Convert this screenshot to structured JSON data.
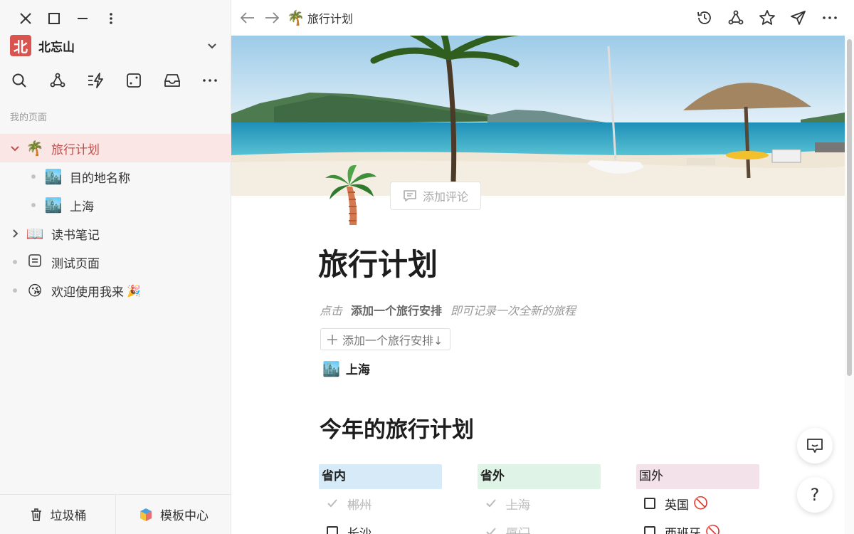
{
  "sidebar": {
    "workspace": {
      "logo_text": "北",
      "name": "北忘山"
    },
    "section_label": "我的页面",
    "tree": [
      {
        "emoji": "🌴",
        "label": "旅行计划",
        "expanded": true,
        "active": true
      },
      {
        "emoji": "🏙️",
        "label": "目的地名称",
        "child": true
      },
      {
        "emoji": "🏙️",
        "label": "上海",
        "child": true
      },
      {
        "emoji": "📖",
        "label": "读书笔记",
        "collapsed": true
      },
      {
        "emoji": "📄",
        "label": "测试页面"
      },
      {
        "emoji": "😘",
        "label": "欢迎使用我来",
        "suffix": "🎉"
      }
    ],
    "footer": {
      "trash": "垃圾桶",
      "templates": "模板中心"
    }
  },
  "topbar": {
    "breadcrumb": {
      "emoji": "🌴",
      "label": "旅行计划"
    }
  },
  "page": {
    "icon": "🌴",
    "comment_button": "添加评论",
    "title": "旅行计划",
    "hint": {
      "prefix": "点击",
      "bold": "添加一个旅行安排",
      "suffix": "即可记录一次全新的旅程"
    },
    "add_button": "添加一个旅行安排↓",
    "linked_page": {
      "emoji": "🏙️",
      "label": "上海"
    },
    "section_heading": "今年的旅行计划",
    "columns": [
      {
        "header": "省内",
        "color": "#d6ebf7",
        "items": [
          {
            "text": "郴州",
            "done": true
          },
          {
            "text": "长沙",
            "done": false
          }
        ]
      },
      {
        "header": "省外",
        "color": "#dff3e6",
        "items": [
          {
            "text": "上海",
            "done": true
          },
          {
            "text": "厦门",
            "done": true
          }
        ]
      },
      {
        "header": "国外",
        "color": "#f4e2ea",
        "items": [
          {
            "text": "英国",
            "done": false,
            "badge": "🚫"
          },
          {
            "text": "西班牙",
            "done": false,
            "badge": "🚫"
          }
        ]
      }
    ]
  },
  "colors": {
    "accent": "#c0504d",
    "active_bg": "#fbe6e6"
  }
}
